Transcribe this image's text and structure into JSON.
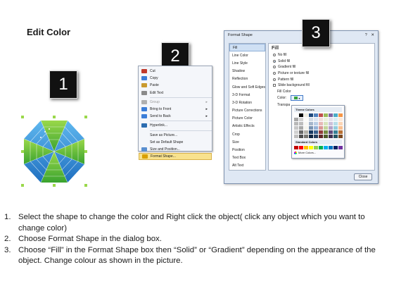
{
  "title": "Edit Color",
  "badges": {
    "step1": "1",
    "step2": "2",
    "step3": "3"
  },
  "context_menu": {
    "items": [
      {
        "label": "Cut",
        "icon": "scissors-icon",
        "color": "#c0392b",
        "disabled": false
      },
      {
        "label": "Copy",
        "icon": "copy-icon",
        "color": "#3b7dd8",
        "disabled": false
      },
      {
        "label": "Paste",
        "icon": "paste-icon",
        "color": "#c99a2e",
        "disabled": false
      },
      {
        "label": "Edit Text",
        "icon": "text-icon",
        "color": "#8a8a8a",
        "disabled": false
      },
      {
        "label": "Group",
        "icon": "group-icon",
        "color": "#b0b0b0",
        "disabled": true,
        "submenu": true
      },
      {
        "label": "Bring to Front",
        "icon": "bring-front-icon",
        "color": "#3b7dd8",
        "disabled": false,
        "submenu": true
      },
      {
        "label": "Send to Back",
        "icon": "send-back-icon",
        "color": "#3b7dd8",
        "disabled": false,
        "submenu": true
      },
      {
        "label": "Hyperlink...",
        "icon": "link-icon",
        "color": "#2c6db0",
        "disabled": false
      },
      {
        "label": "Save as Picture...",
        "icon": "blank-icon",
        "color": "transparent",
        "disabled": false
      },
      {
        "label": "Set as Default Shape",
        "icon": "blank-icon",
        "color": "transparent",
        "disabled": false
      },
      {
        "label": "Size and Position...",
        "icon": "size-icon",
        "color": "#5a8fd0",
        "disabled": false
      },
      {
        "label": "Format Shape...",
        "icon": "format-icon",
        "color": "#d9a000",
        "disabled": false,
        "highlighted": true
      }
    ]
  },
  "dialog": {
    "title": "Format Shape",
    "controls": [
      "?",
      "✕"
    ],
    "categories": [
      "Fill",
      "Line Color",
      "Line Style",
      "Shadow",
      "Reflection",
      "Glow and Soft Edges",
      "3-D Format",
      "3-D Rotation",
      "Picture Corrections",
      "Picture Color",
      "Artistic Effects",
      "Crop",
      "Size",
      "Position",
      "Text Box",
      "Alt Text"
    ],
    "selected_category": "Fill",
    "fill_heading": "Fill",
    "fill_options": [
      {
        "label": "No fill",
        "on": false
      },
      {
        "label": "Solid fill",
        "on": true
      },
      {
        "label": "Gradient fill",
        "on": false
      },
      {
        "label": "Picture or texture fill",
        "on": false
      },
      {
        "label": "Pattern fill",
        "on": false
      }
    ],
    "slide_bg_label": "Slide background fill",
    "fill_color_label": "Fill Color",
    "color_label": "Color:",
    "transparency_label": "Transpa",
    "close_label": "Close"
  },
  "palette": {
    "theme_label": "Theme Colors",
    "standard_label": "Standard Colors",
    "more_label": "More Colors...",
    "theme_top": [
      "#ffffff",
      "#000000",
      "#eeece1",
      "#1f497d",
      "#4f81bd",
      "#c0504d",
      "#9bbb59",
      "#8064a2",
      "#4bacc6",
      "#f79646"
    ],
    "standard": [
      "#c00000",
      "#ff0000",
      "#ffc000",
      "#ffff00",
      "#92d050",
      "#00b050",
      "#00b0f0",
      "#0070c0",
      "#002060",
      "#7030a0"
    ]
  },
  "instructions": [
    {
      "num": "1.",
      "text": "Select the shape to change the color and Right click the object( click any object which you want to change color)"
    },
    {
      "num": "2.",
      "text": "Choose Format Shape in the dialog box."
    },
    {
      "num": "3.",
      "text": "Choose “Fill” in the Format Shape box then “Solid” or “Gradient” depending on the appearance of the object. Change colour as shown in the picture."
    }
  ]
}
